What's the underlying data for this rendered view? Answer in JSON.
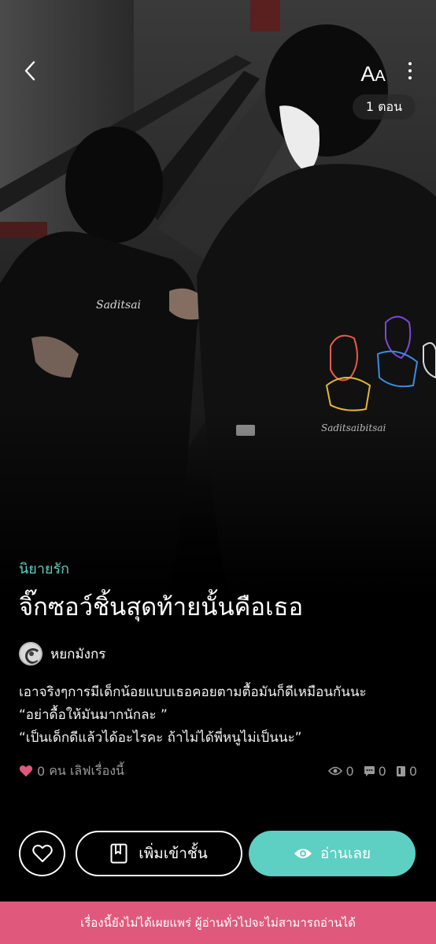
{
  "header": {
    "font_size_label_big": "A",
    "font_size_label_small": "A",
    "episode_count": "1 ตอน"
  },
  "novel": {
    "category": "นิยายรัก",
    "title": "จิ๊กซอว์ชิ้นสุดท้ายนั้นคือเธอ",
    "author": "หยกมังกร",
    "synopsis": [
      "เอาจริงๆการมีเด็กน้อยแบบเธอคอยตามตื้อมันก็ดีเหมือนกันนะ",
      "“อย่าดื้อให้มันมากนักละ ”",
      "“เป็นเด็กดีแล้วได้อะไรคะ ถ้าไม่ได้พี่หนูไม่เป็นนะ”"
    ]
  },
  "stats": {
    "love_count": "0",
    "love_text": "คน เลิฟเรื่องนี้",
    "views": "0",
    "comments": "0",
    "episodes": "0"
  },
  "actions": {
    "add_library_label": "เพิ่มเข้าชั้น",
    "read_label": "อ่านเลย"
  },
  "notice": {
    "text": "เรื่องนี้ยังไม่ได้เผยแพร่ ผู้อ่านทั่วไปจะไม่สามารถอ่านได้"
  },
  "colors": {
    "accent": "#5ecfc3",
    "notice_bg": "#e0597d",
    "heart": "#e0597d",
    "muted": "#9a9a9a",
    "background": "#000000"
  },
  "icons": {
    "back": "chevron-left-icon",
    "more": "more-vertical-icon",
    "heart": "heart-icon",
    "view": "eye-icon",
    "comment": "comment-icon",
    "episodes": "book-icon",
    "library": "bookmark-icon",
    "read": "eye-icon"
  }
}
